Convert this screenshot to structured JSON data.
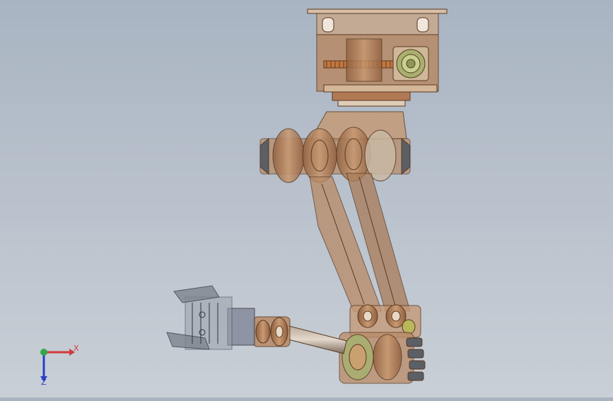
{
  "viewport": {
    "background_top": "#a9b4c2",
    "background_bottom": "#c9cfd6"
  },
  "model": {
    "primary_color": "#b07a55",
    "edge_color": "#5a3a22",
    "joint_color": "#c8a070",
    "shaft_color": "#8d7a6a",
    "gripper_color": "#7d858e",
    "motor_face_color": "#a8b070"
  },
  "triad": {
    "x_label": "X",
    "z_label": "Z",
    "x_color": "#d23a3a",
    "y_color": "#2fa84a",
    "z_color": "#2a3fc7"
  }
}
